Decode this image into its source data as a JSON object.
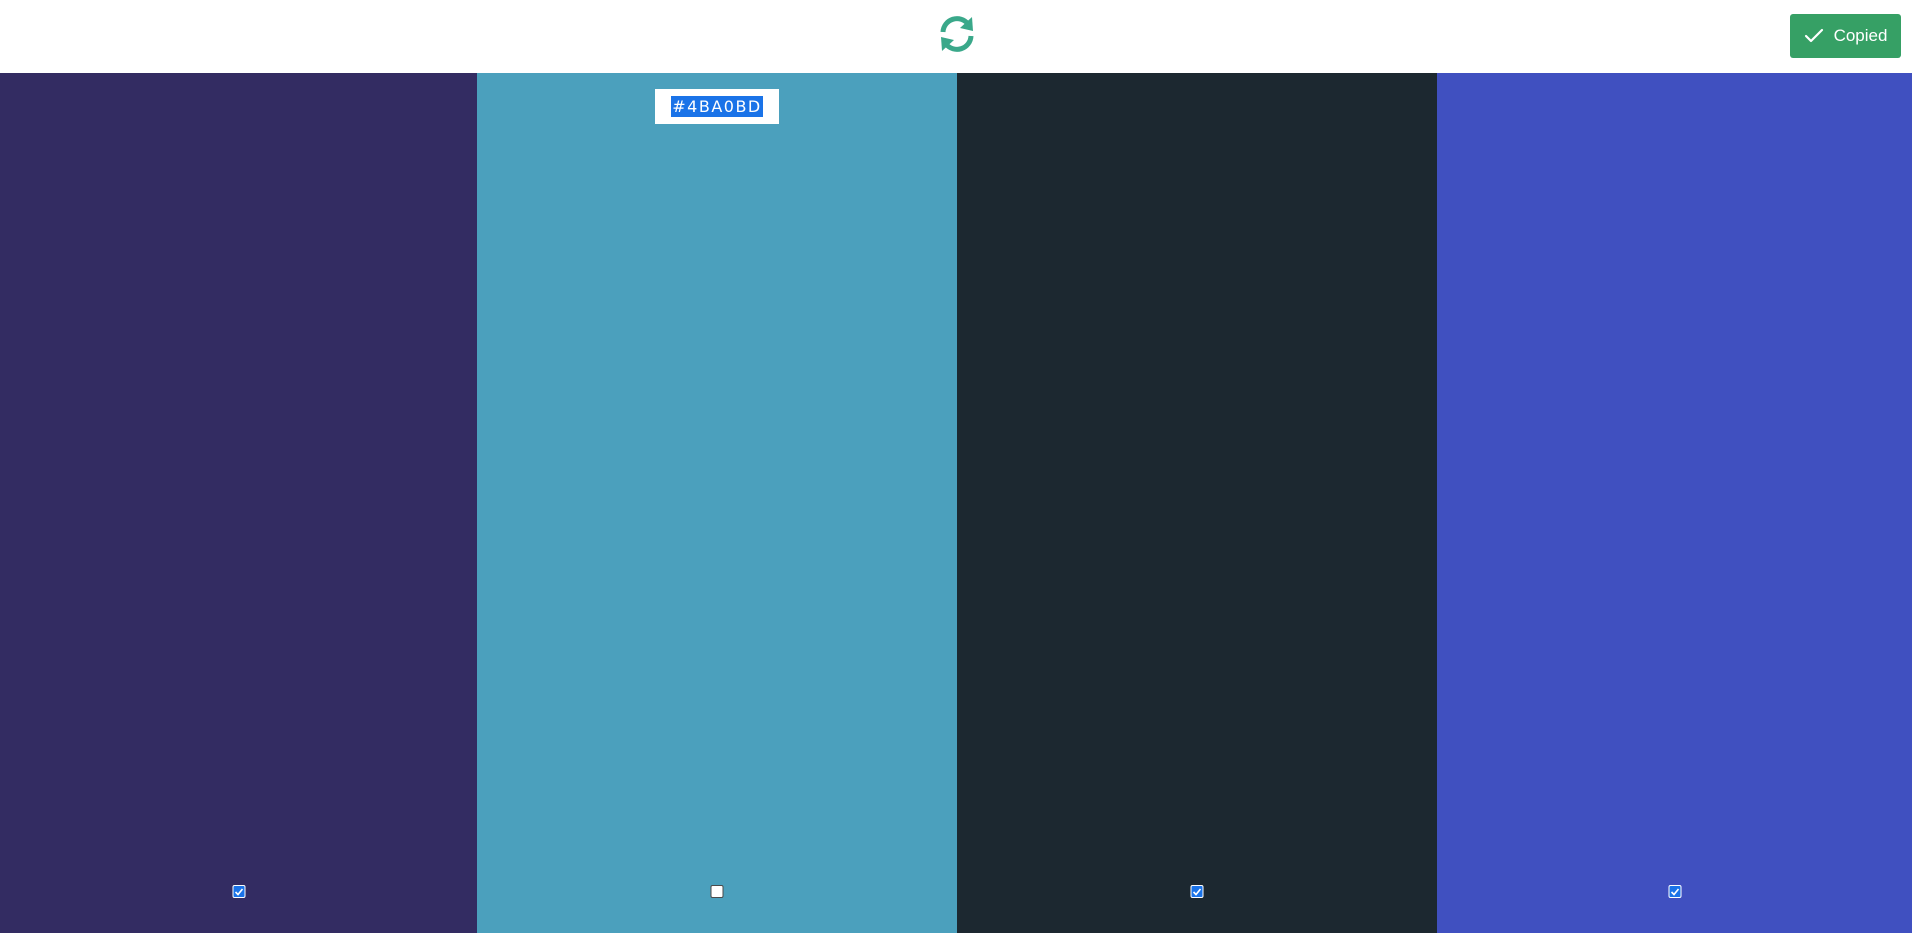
{
  "header": {
    "refresh_icon": "refresh-cycle-icon",
    "refresh_color": "#3aa88a",
    "toast": {
      "label": "Copied",
      "icon": "checkmark-icon",
      "background": "#36a065"
    }
  },
  "swatches": [
    {
      "color": "#332c62",
      "hex": "",
      "locked": true
    },
    {
      "color": "#4ba0bd",
      "hex": "#4BA0BD",
      "locked": false,
      "editing": true
    },
    {
      "color": "#1c2830",
      "hex": "",
      "locked": true
    },
    {
      "color": "#4050c0",
      "hex": "",
      "locked": true
    }
  ],
  "selection_color": "#1a73e8"
}
